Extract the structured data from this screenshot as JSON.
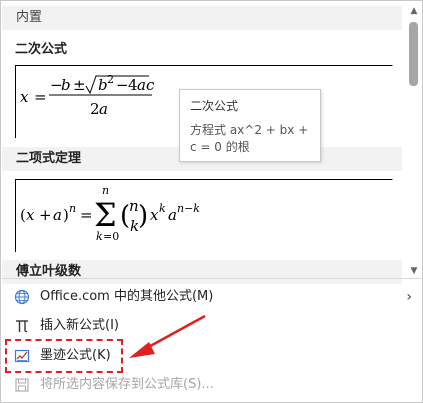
{
  "gallery": {
    "builtin_header": "内置",
    "formulas": [
      {
        "title": "二次公式",
        "expression": "x = (−b ± √(b^2 − 4ac)) / 2a"
      },
      {
        "title": "二项式定理",
        "expression": "(x + a)^n = Σ_{k=0}^{n} C(n,k) x^k a^{n−k}"
      },
      {
        "title": "傅立叶级数"
      }
    ],
    "tooltip": {
      "title": "二次公式",
      "line1": "方程式 ax^2 + bx +",
      "line2": "c = 0 的根"
    }
  },
  "menu": {
    "items": [
      {
        "label": "Office.com 中的其他公式(M)",
        "icon": "globe-icon",
        "has_submenu": true
      },
      {
        "label": "插入新公式(I)",
        "icon": "pi-icon"
      },
      {
        "label": "墨迹公式(K)",
        "icon": "ink-equation-icon"
      },
      {
        "label": "将所选内容保存到公式库(S)...",
        "icon": "save-gallery-icon",
        "disabled": true
      }
    ]
  },
  "colors": {
    "highlight_border": "#e02020",
    "arrow": "#e02020",
    "disabled_text": "#a6a6a6",
    "header_bg": "#f2f2f2"
  }
}
